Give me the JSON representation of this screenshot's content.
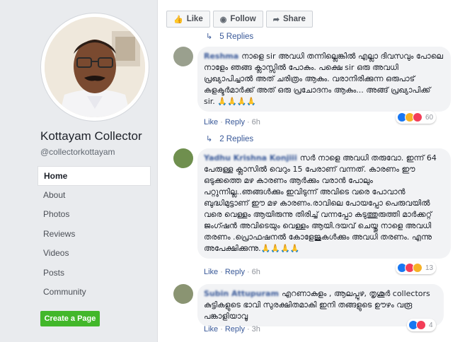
{
  "sidebar": {
    "page_name": "Kottayam Collector",
    "handle": "@collectorkottayam",
    "nav": [
      "Home",
      "About",
      "Photos",
      "Reviews",
      "Videos",
      "Posts",
      "Community"
    ],
    "create_page": "Create a Page"
  },
  "toolbar": {
    "like": "Like",
    "follow": "Follow",
    "share": "Share"
  },
  "thread": {
    "top_replies": "5 Replies",
    "comments": [
      {
        "author": "Reshma",
        "text": "നാളെ sir അവധി തന്നില്ലെങ്കിൽ എല്ലാ ദിവസവും പോലെ നാളേം ഞങ്ങ ക്ലാസ്സിൽ പോകും. പക്ഷെ sir ഒരു അവധി പ്രഖ്യാപിച്ചാൽ അത് ചരിത്രം ആകും. വരാനിരിക്കുന്ന ഒരുപാട് കളക്ടർമാർക്ക് അത് ഒരു പ്രചോദനം ആകും... അങ്ങ് പ്രഖ്യാപിക്ക് sir. 🙏🙏🙏🙏",
        "like": "Like",
        "reply": "Reply",
        "time": "6h",
        "reactions": "60",
        "replies": "2 Replies"
      },
      {
        "author": "Yadhu Krishna Konjiii",
        "text": "സർ നാളെ അവധി തരുവോ. ഇന്ന് 64 പേരുള്ള ക്ലാസിൽ വെറും 15 പേരാണ് വന്നത്. കാരണം ഈ ഒടുക്കത്തെ മഴ കാരണം ആർക്കും വരാൻ പോലും പറ്റുന്നില്ല..ഞങ്ങൾക്കും ഇവിടുന്ന് അവിടെ വരെ പോവാൻ ബുദ്ധിമുട്ടാണ് ഈ മഴ കാരണം.രാവിലെ പോയപ്പോ പെരുവയിൽ വരെ വെള്ളം ആയിരുന്നു തിരിച്ച് വന്നപ്പോ കടുത്തുരുത്തി മാർക്കറ്റ് ജംഗ്ഷൻ അവിടെയും വെള്ളം ആയി.ദയവ് ചെയ്തു നാളെ അവധി തരണം .പ്രൊഫഷനൽ കോളേജുകൾക്കും അവധി തരണം. എന്നു അപേക്ഷിക്കുന്നു.🙏🙏🙏🙏",
        "like": "Like",
        "reply": "Reply",
        "time": "6h",
        "reactions": "13"
      },
      {
        "author": "Subin Attupuram",
        "text": "എറണാകുളം , ആലപ്പുഴ, തൃശൂർ collectors കുട്ടികളുടെ ഭാവി സുരക്ഷിതമാകി ഇനി തങ്ങളുടെ ഊഴം വരൂ പങ്കാളിയാവൂ",
        "like": "Like",
        "reply": "Reply",
        "time": "3h",
        "reactions": "4"
      }
    ]
  },
  "colors": {
    "link": "#385898",
    "create_btn": "#42b72a",
    "bg": "#e9ebee"
  }
}
